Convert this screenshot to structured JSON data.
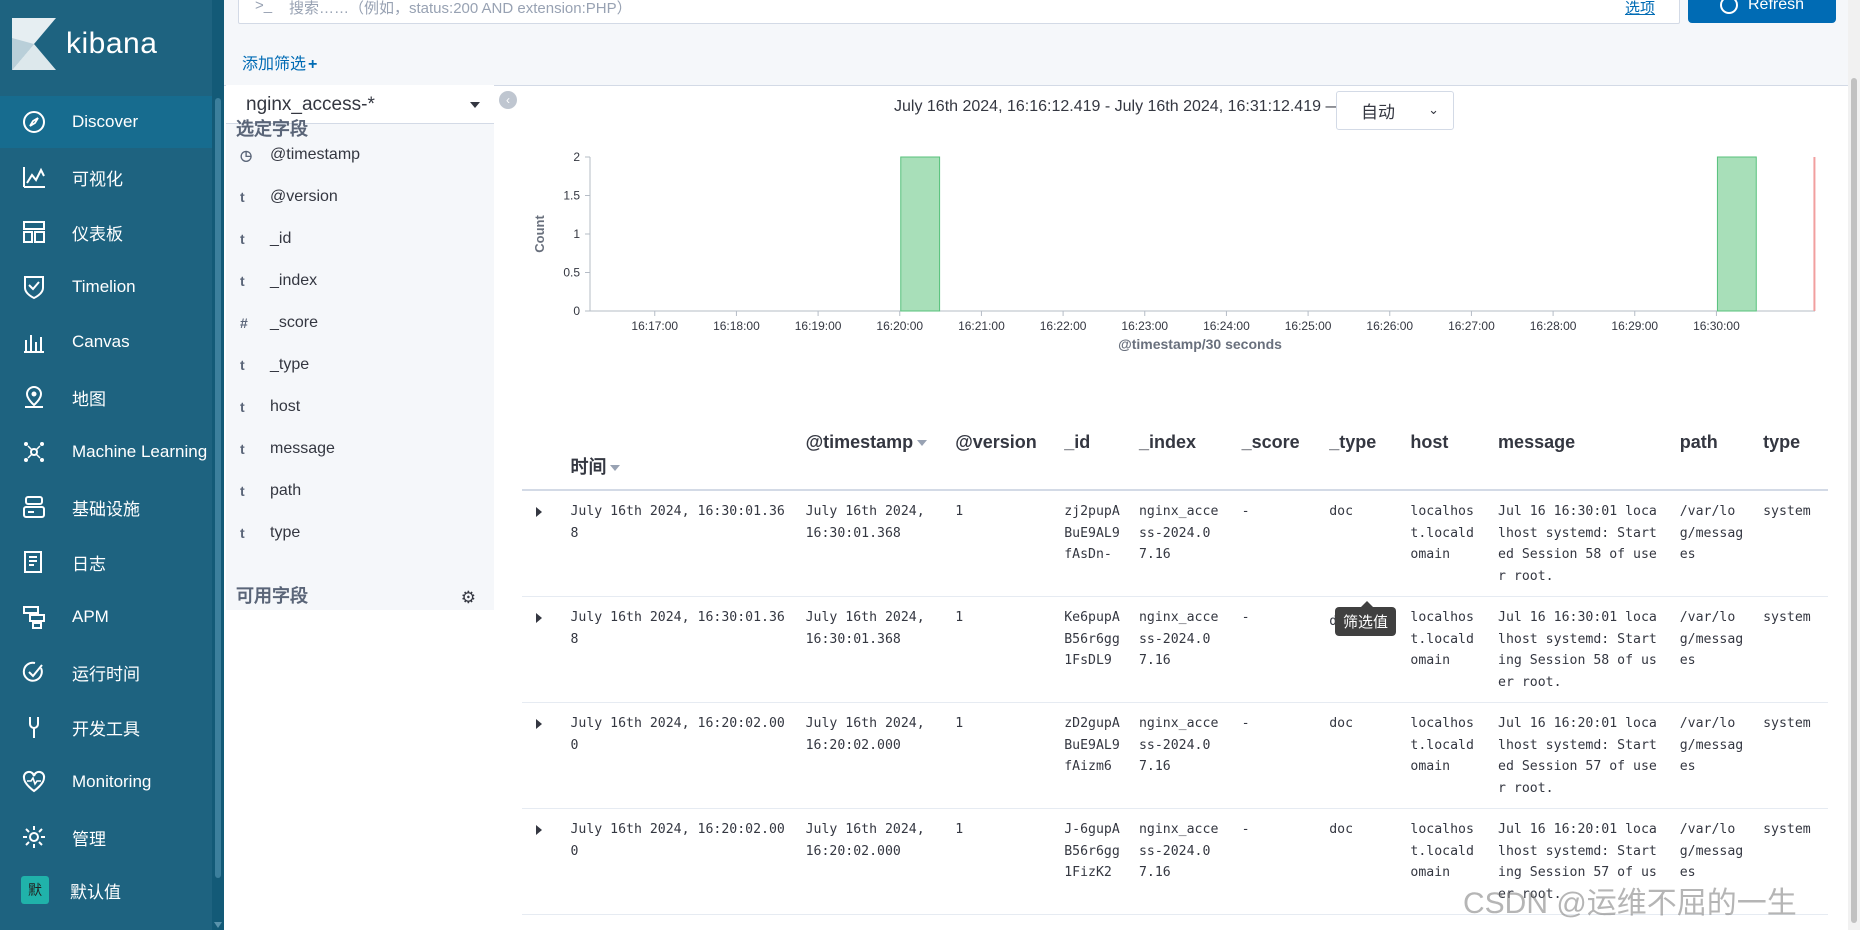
{
  "app": {
    "brand": "kibana"
  },
  "nav": {
    "items": [
      {
        "label": "Discover",
        "icon": "compass-icon",
        "active": true
      },
      {
        "label": "可视化",
        "icon": "visualize-icon"
      },
      {
        "label": "仪表板",
        "icon": "dashboard-icon"
      },
      {
        "label": "Timelion",
        "icon": "timelion-icon"
      },
      {
        "label": "Canvas",
        "icon": "canvas-icon"
      },
      {
        "label": "地图",
        "icon": "map-pin-icon"
      },
      {
        "label": "Machine Learning",
        "icon": "machine-learning-icon"
      },
      {
        "label": "基础设施",
        "icon": "infrastructure-icon"
      },
      {
        "label": "日志",
        "icon": "logs-icon"
      },
      {
        "label": "APM",
        "icon": "apm-icon"
      },
      {
        "label": "运行时间",
        "icon": "uptime-icon"
      },
      {
        "label": "开发工具",
        "icon": "wrench-icon"
      },
      {
        "label": "Monitoring",
        "icon": "heartbeat-icon"
      },
      {
        "label": "管理",
        "icon": "gear-icon"
      }
    ],
    "user": {
      "avatar": "默",
      "label": "默认值"
    }
  },
  "search": {
    "prompt": ">_",
    "placeholder": "搜索……（例如，status:200 AND extension:PHP）",
    "options_label": "选项",
    "refresh_label": "Refresh"
  },
  "filters": {
    "add_label": "添加筛选",
    "add_icon": "+"
  },
  "sidebar": {
    "index_pattern": "nginx_access-*",
    "selected_title": "选定字段",
    "available_title": "可用字段",
    "fields": [
      {
        "type": "clock",
        "name": "@timestamp"
      },
      {
        "type": "t",
        "name": "@version"
      },
      {
        "type": "t",
        "name": "_id"
      },
      {
        "type": "t",
        "name": "_index"
      },
      {
        "type": "#",
        "name": "_score"
      },
      {
        "type": "t",
        "name": "_type"
      },
      {
        "type": "t",
        "name": "host"
      },
      {
        "type": "t",
        "name": "message"
      },
      {
        "type": "t",
        "name": "path"
      },
      {
        "type": "t",
        "name": "type"
      }
    ]
  },
  "main": {
    "time_range": "July 16th 2024, 16:16:12.419 - July 16th 2024, 16:31:12.419 —",
    "interval": "自动"
  },
  "chart_data": {
    "type": "bar",
    "ylabel": "Count",
    "xlabel": "@timestamp/30 seconds",
    "ylim": [
      0,
      2
    ],
    "yticks": [
      "0",
      "0.5",
      "1",
      "1.5",
      "2"
    ],
    "xticks": [
      "16:17:00",
      "16:18:00",
      "16:19:00",
      "16:20:00",
      "16:21:00",
      "16:22:00",
      "16:23:00",
      "16:24:00",
      "16:25:00",
      "16:26:00",
      "16:27:00",
      "16:28:00",
      "16:29:00",
      "16:30:00"
    ],
    "x_start": "16:16:12.419",
    "x_end": "16:31:12.419",
    "bars": [
      {
        "start": "16:20:00",
        "end": "16:20:30",
        "value": 2
      },
      {
        "start": "16:30:00",
        "end": "16:30:30",
        "value": 2
      }
    ],
    "now_marker": "16:31:12",
    "bar_color": "#a8dfb9",
    "bar_border": "#57c17b",
    "now_color": "#f19f9f"
  },
  "table": {
    "columns": [
      "时间",
      "@timestamp",
      "@version",
      "_id",
      "_index",
      "_score",
      "_type",
      "host",
      "message",
      "path",
      "type"
    ],
    "rows": [
      [
        "July 16th 2024, 16:30:01.368",
        "July 16th 2024, 16:30:01.368",
        "1",
        "zj2pupABuE9AL9fAsDn-",
        "nginx_access-2024.07.16",
        "-",
        "doc",
        "localhost.localdomain",
        "Jul 16 16:30:01 localhost systemd: Started Session 58 of user root.",
        "/var/log/messages",
        "system"
      ],
      [
        "July 16th 2024, 16:30:01.368",
        "July 16th 2024, 16:30:01.368",
        "1",
        "Ke6pupAB56r6gg1FsDL9",
        "nginx_access-2024.07.16",
        "-",
        "do",
        "localhost.localdomain",
        "Jul 16 16:30:01 localhost systemd: Starting Session 58 of user root.",
        "/var/log/messages",
        "system"
      ],
      [
        "July 16th 2024, 16:20:02.000",
        "July 16th 2024, 16:20:02.000",
        "1",
        "zD2gupABuE9AL9fAizm6",
        "nginx_access-2024.07.16",
        "-",
        "doc",
        "localhost.localdomain",
        "Jul 16 16:20:01 localhost systemd: Started Session 57 of user root.",
        "/var/log/messages",
        "system"
      ],
      [
        "July 16th 2024, 16:20:02.000",
        "July 16th 2024, 16:20:02.000",
        "1",
        "J-6gupAB56r6gg1FizK2",
        "nginx_access-2024.07.16",
        "-",
        "doc",
        "localhost.localdomain",
        "Jul 16 16:20:01 localhost systemd: Starting Session 57 of user root.",
        "/var/log/messages",
        "system"
      ]
    ],
    "tooltip": "筛选值"
  },
  "watermark": "CSDN @运维不屈的一生"
}
